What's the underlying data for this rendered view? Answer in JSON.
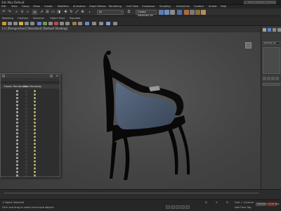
{
  "window": {
    "title": "3ds Max Default",
    "search_placeholder": "Type a keyword or phrase"
  },
  "menubar": [
    "Edit",
    "Tools",
    "Group",
    "Views",
    "Create",
    "Modifiers",
    "Animation",
    "Graph Editors",
    "Rendering",
    "Civil View",
    "Customize",
    "Scripting",
    "Interactive",
    "Content",
    "Arnold",
    "Help"
  ],
  "toolbar": {
    "selection_filter": "All",
    "named_selection_placeholder": "Create Selection Se"
  },
  "ribbon": {
    "tabs": [
      "Modeling",
      "Freeform",
      "Selection",
      "Object Paint",
      "Populate"
    ]
  },
  "viewport": {
    "label": "[+] [Perspective] [Standard] [Default Shading]"
  },
  "command_panel": {
    "object_name": "Retofas sta",
    "modifier_list": "Modifier List"
  },
  "scene_explorer": {
    "columns": [
      "Frozen",
      "Renderable",
      "Color",
      "Radiosity"
    ],
    "row_count": 25
  },
  "statusbar": {
    "selection_status": "1 Object Selected",
    "prompt": "Click and drag to select and move objects",
    "x": "X:",
    "y": "Y:",
    "z": "Z:",
    "grid": "Grid = 10,0mm",
    "add_time_tag": "Add Time Tag",
    "selected_label": "Selected",
    "auto_key": "Auto Key",
    "set_key": "Set Key"
  },
  "colors": {
    "accent": "#4a86c8",
    "chair_body": "#070707",
    "upholstery": "#4e5d72",
    "auto_key": "#6a1a1a"
  }
}
